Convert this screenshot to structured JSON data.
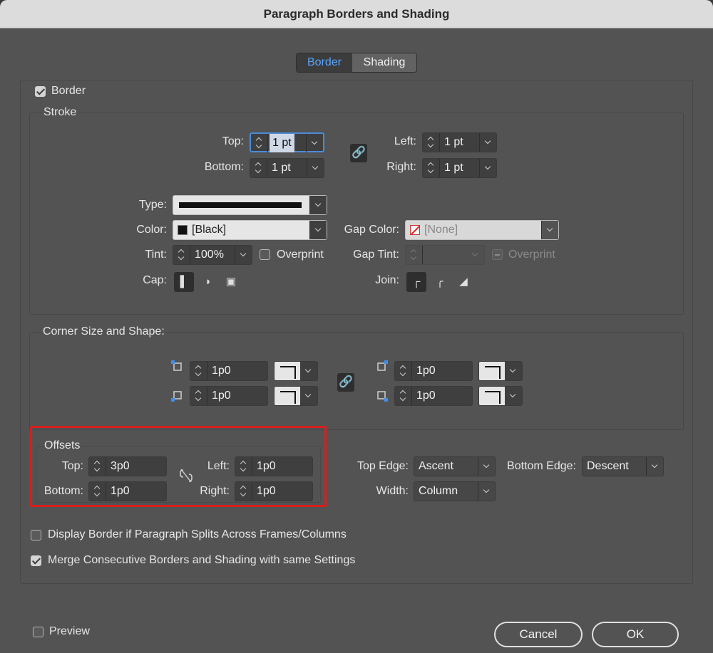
{
  "dialog": {
    "title": "Paragraph Borders and Shading"
  },
  "tabs": {
    "border": "Border",
    "shading": "Shading"
  },
  "border_checkbox": {
    "label": "Border",
    "checked": true
  },
  "stroke": {
    "legend": "Stroke",
    "top_label": "Top:",
    "top_value": "1 pt",
    "bottom_label": "Bottom:",
    "bottom_value": "1 pt",
    "left_label": "Left:",
    "left_value": "1 pt",
    "right_label": "Right:",
    "right_value": "1 pt",
    "type_label": "Type:",
    "color_label": "Color:",
    "color_value": "[Black]",
    "tint_label": "Tint:",
    "tint_value": "100%",
    "overprint_label": "Overprint",
    "gap_color_label": "Gap Color:",
    "gap_color_value": "[None]",
    "gap_tint_label": "Gap Tint:",
    "gap_tint_value": "",
    "gap_overprint_label": "Overprint",
    "cap_label": "Cap:",
    "join_label": "Join:"
  },
  "corner": {
    "legend": "Corner Size and Shape:",
    "top_left": "1p0",
    "bottom_left": "1p0",
    "top_right": "1p0",
    "bottom_right": "1p0"
  },
  "offsets": {
    "legend": "Offsets",
    "top_label": "Top:",
    "top_value": "3p0",
    "bottom_label": "Bottom:",
    "bottom_value": "1p0",
    "left_label": "Left:",
    "left_value": "1p0",
    "right_label": "Right:",
    "right_value": "1p0"
  },
  "edges": {
    "top_edge_label": "Top Edge:",
    "top_edge_value": "Ascent",
    "bottom_edge_label": "Bottom Edge:",
    "bottom_edge_value": "Descent",
    "width_label": "Width:",
    "width_value": "Column"
  },
  "options": {
    "display_border_label": "Display Border if Paragraph Splits Across Frames/Columns",
    "merge_label": "Merge Consecutive Borders and Shading with same Settings"
  },
  "footer": {
    "preview_label": "Preview",
    "cancel_label": "Cancel",
    "ok_label": "OK"
  },
  "colors": {
    "highlight": "#d81e1e",
    "tab_active": "#59a6ff"
  }
}
